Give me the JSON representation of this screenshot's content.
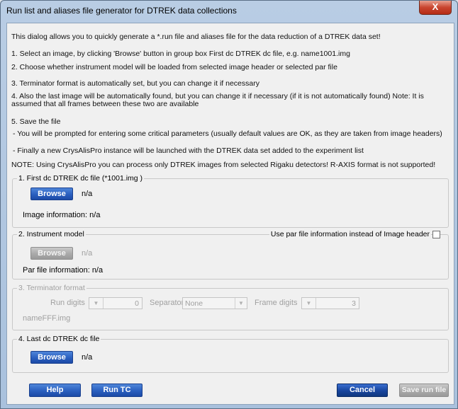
{
  "window": {
    "title": "Run list and aliases file generator for DTREK data collections",
    "close_glyph": "X"
  },
  "instructions": {
    "intro": "This dialog allows you to quickly generate a *.run file and aliases file for the data reduction of a DTREK data set!",
    "step1": "1. Select an image, by clicking 'Browse' button in group box First dc DTREK dc file, e.g. name1001.img",
    "step2": "2. Choose whether instrument model will be loaded from selected image header or selected par file",
    "step3": "3. Terminator format is automatically set, but you can change it if necessary",
    "step4": "4. Also the last image will be automatically found, but you can change it if necessary (if it is not automatically found) Note: It is assumed that all frames between these two are available",
    "step5": "5. Save the file",
    "step5_sub1": "- You will be prompted for entering some critical parameters (usually default values are OK, as they are taken from image headers)",
    "step5_sub2": "- Finally a new CrysAlisPro instance will be launched with the DTREK data set added to the experiment list",
    "note": "NOTE: Using CrysAlisPro you can process only DTREK images from selected Rigaku detectors! R-AXIS format is not supported!"
  },
  "group_first": {
    "title": "1. First dc DTREK dc file (*1001.img )",
    "browse_label": "Browse",
    "file_value": "n/a",
    "image_info": "Image information: n/a"
  },
  "group_instrument": {
    "title": "2. Instrument model",
    "use_par_label": "Use par file information instead of Image header",
    "use_par_checked": false,
    "browse_label": "Browse",
    "file_value": "n/a",
    "par_info": "Par file information: n/a"
  },
  "group_terminator": {
    "title": "3. Terminator format",
    "run_digits_label": "Run digits",
    "run_digits_value": "0",
    "separator_label": "Separator",
    "separator_value": "None",
    "frame_digits_label": "Frame digits",
    "frame_digits_value": "3",
    "pattern": "nameFFF.img"
  },
  "group_last": {
    "title": "4. Last dc DTREK dc file",
    "browse_label": "Browse",
    "file_value": "n/a"
  },
  "footer": {
    "help_label": "Help",
    "run_tc_label": "Run TC",
    "cancel_label": "Cancel",
    "save_label": "Save run file"
  }
}
